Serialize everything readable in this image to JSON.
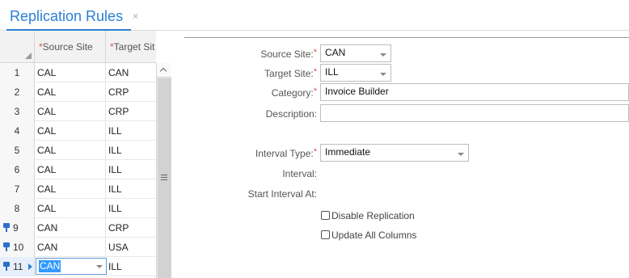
{
  "tab": {
    "label": "Replication Rules",
    "close": "×"
  },
  "grid": {
    "columns": [
      {
        "required_mark": "*",
        "label": "Source Site"
      },
      {
        "required_mark": "*",
        "label": "Target Sit"
      }
    ],
    "rows": [
      {
        "num": "1",
        "source": "CAL",
        "target": "CAN",
        "pinned": false
      },
      {
        "num": "2",
        "source": "CAL",
        "target": "CRP",
        "pinned": false
      },
      {
        "num": "3",
        "source": "CAL",
        "target": "CRP",
        "pinned": false
      },
      {
        "num": "4",
        "source": "CAL",
        "target": "ILL",
        "pinned": false
      },
      {
        "num": "5",
        "source": "CAL",
        "target": "ILL",
        "pinned": false
      },
      {
        "num": "6",
        "source": "CAL",
        "target": "ILL",
        "pinned": false
      },
      {
        "num": "7",
        "source": "CAL",
        "target": "ILL",
        "pinned": false
      },
      {
        "num": "8",
        "source": "CAL",
        "target": "ILL",
        "pinned": false
      },
      {
        "num": "9",
        "source": "CAN",
        "target": "CRP",
        "pinned": true
      },
      {
        "num": "10",
        "source": "CAN",
        "target": "USA",
        "pinned": true
      },
      {
        "num": "11",
        "source": "CAN",
        "target": "ILL",
        "pinned": true,
        "selected": true,
        "editing": true
      }
    ]
  },
  "form": {
    "source_site": {
      "label": "Source Site:",
      "required": "*",
      "value": "CAN"
    },
    "target_site": {
      "label": "Target Site:",
      "required": "*",
      "value": "ILL"
    },
    "category": {
      "label": "Category:",
      "required": "*",
      "value": "Invoice Builder"
    },
    "description": {
      "label": "Description:",
      "value": ""
    },
    "interval_type": {
      "label": "Interval Type:",
      "required": "*",
      "value": "Immediate"
    },
    "interval": {
      "label": "Interval:"
    },
    "start_interval_at": {
      "label": "Start Interval At:"
    },
    "disable_replication": {
      "label": "Disable Replication",
      "checked": false
    },
    "update_all_columns": {
      "label": "Update All Columns",
      "checked": false
    }
  },
  "icons": {
    "pin": "pin-icon",
    "row_arrow": "current-row-arrow-icon",
    "dropdown": "chevron-down-icon"
  },
  "colors": {
    "accent": "#2a7fd4",
    "required": "#d9534f",
    "pin": "#2a6fc9",
    "selection": "#3399ff"
  }
}
